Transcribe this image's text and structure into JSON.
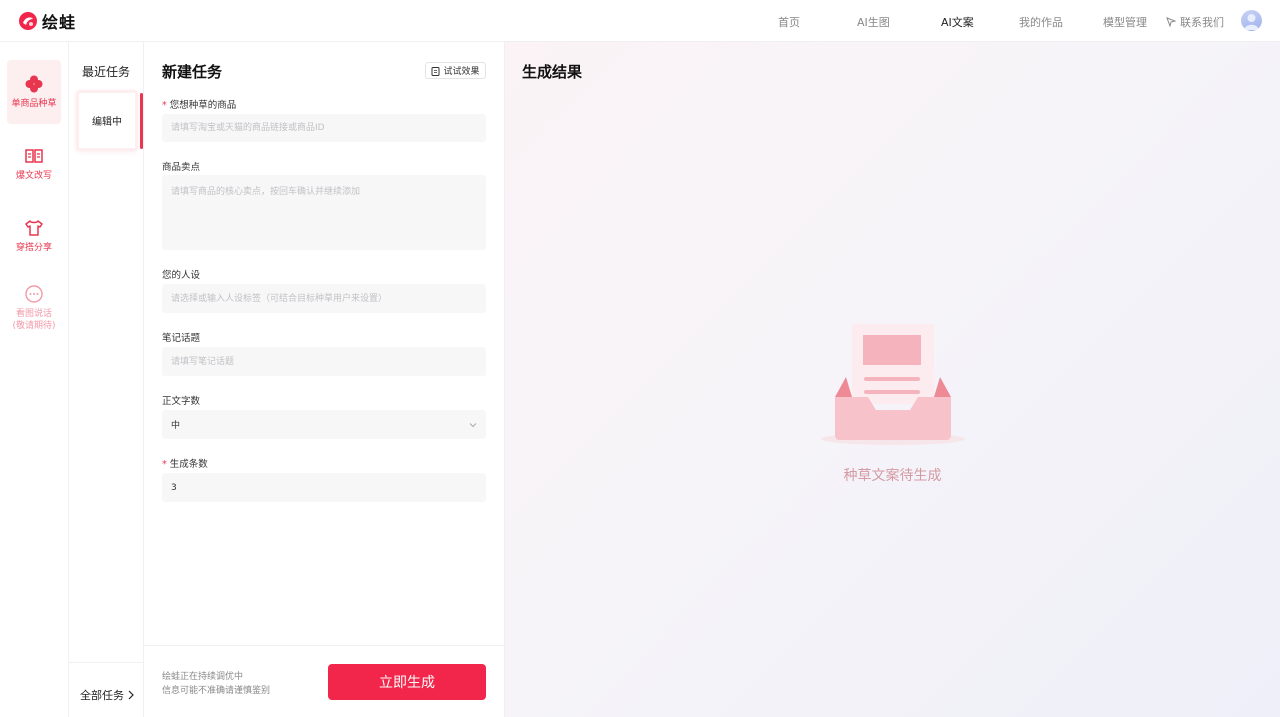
{
  "app": {
    "name": "绘蛙"
  },
  "nav": {
    "items": [
      "首页",
      "AI生图",
      "AI文案",
      "我的作品",
      "模型管理"
    ],
    "active_index": 2,
    "contact": "联系我们"
  },
  "sidebar": {
    "items": [
      {
        "label": "单商品种草",
        "icon": "clover-icon",
        "active": true
      },
      {
        "label": "爆文改写",
        "icon": "book-icon"
      },
      {
        "label": "穿搭分享",
        "icon": "shirt-icon"
      },
      {
        "label": "看图说话",
        "label2": "(敬请期待)",
        "icon": "chat-icon",
        "disabled": true
      }
    ]
  },
  "recent": {
    "title": "最近任务",
    "card_label": "编辑中",
    "all_tasks": "全部任务"
  },
  "form": {
    "title": "新建任务",
    "try_button": "试试效果",
    "fields": {
      "product": {
        "label": "您想种草的商品",
        "required": true,
        "placeholder": "请填写淘宝或天猫的商品链接或商品ID"
      },
      "selling_points": {
        "label": "商品卖点",
        "placeholder": "请填写商品的核心卖点，按回车确认并继续添加"
      },
      "persona": {
        "label": "您的人设",
        "placeholder": "请选择或输入人设标签（可结合目标种草用户来设置）"
      },
      "topic": {
        "label": "笔记话题",
        "placeholder": "请填写笔记话题"
      },
      "word_count": {
        "label": "正文字数",
        "value": "中"
      },
      "count": {
        "label": "生成条数",
        "required": true,
        "value": "3"
      }
    },
    "footer_note_1": "绘蛙正在持续调优中",
    "footer_note_2": "信息可能不准确请谨慎鉴别",
    "generate_button": "立即生成"
  },
  "result": {
    "title": "生成结果",
    "empty_text": "种草文案待生成"
  },
  "colors": {
    "accent": "#f2254a",
    "accent_light": "#fdeef0",
    "empty_text": "#d49aa3"
  }
}
